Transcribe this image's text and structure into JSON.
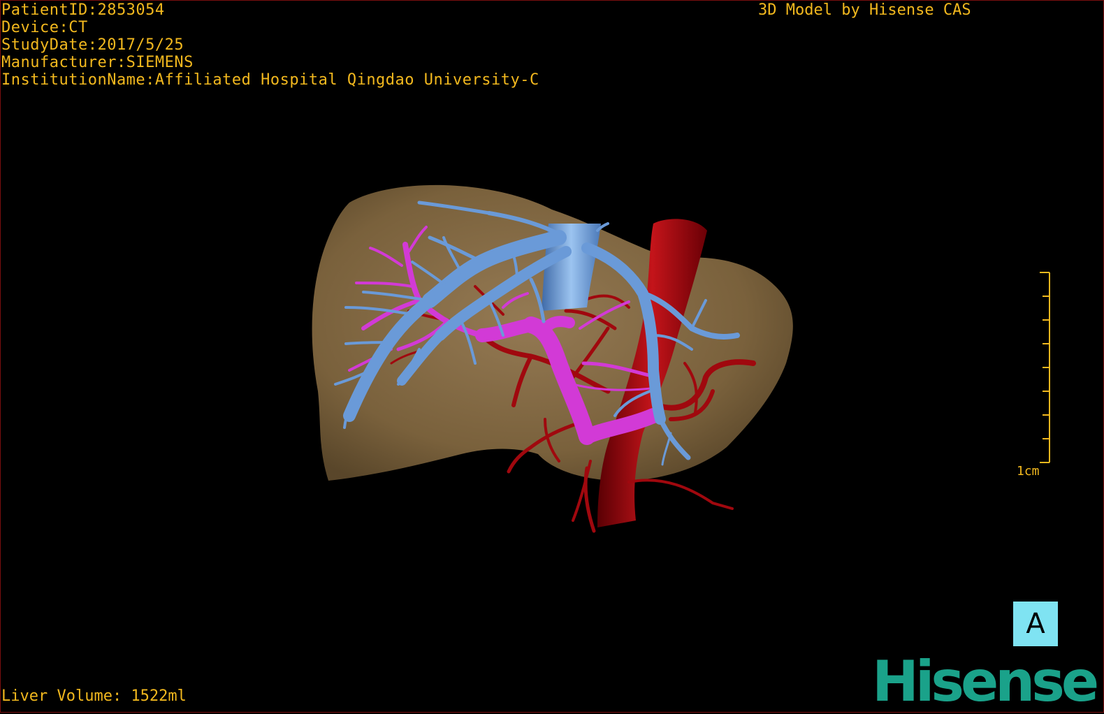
{
  "header": {
    "patient_id": "PatientID:2853054",
    "device": "Device:CT",
    "study_date": "StudyDate:2017/5/25",
    "manufacturer": "Manufacturer:SIEMENS",
    "institution": "InstitutionName:Affiliated Hospital Qingdao University-C"
  },
  "brand_caption": "3D Model by Hisense CAS",
  "footer": {
    "liver_volume": "Liver Volume: 1522ml"
  },
  "scale_bar": {
    "label": "1cm"
  },
  "orientation_button": {
    "label": "A"
  },
  "logo": {
    "text": "Hisense"
  },
  "colors": {
    "overlay_text": "#f2b81e",
    "liver": "#8a6f4a",
    "hepatic_vein": "#6a9ad8",
    "portal_vein": "#d23ad6",
    "artery": "#a0080e",
    "orientation_bg": "#7fe3f2",
    "logo": "#1aa28a"
  }
}
